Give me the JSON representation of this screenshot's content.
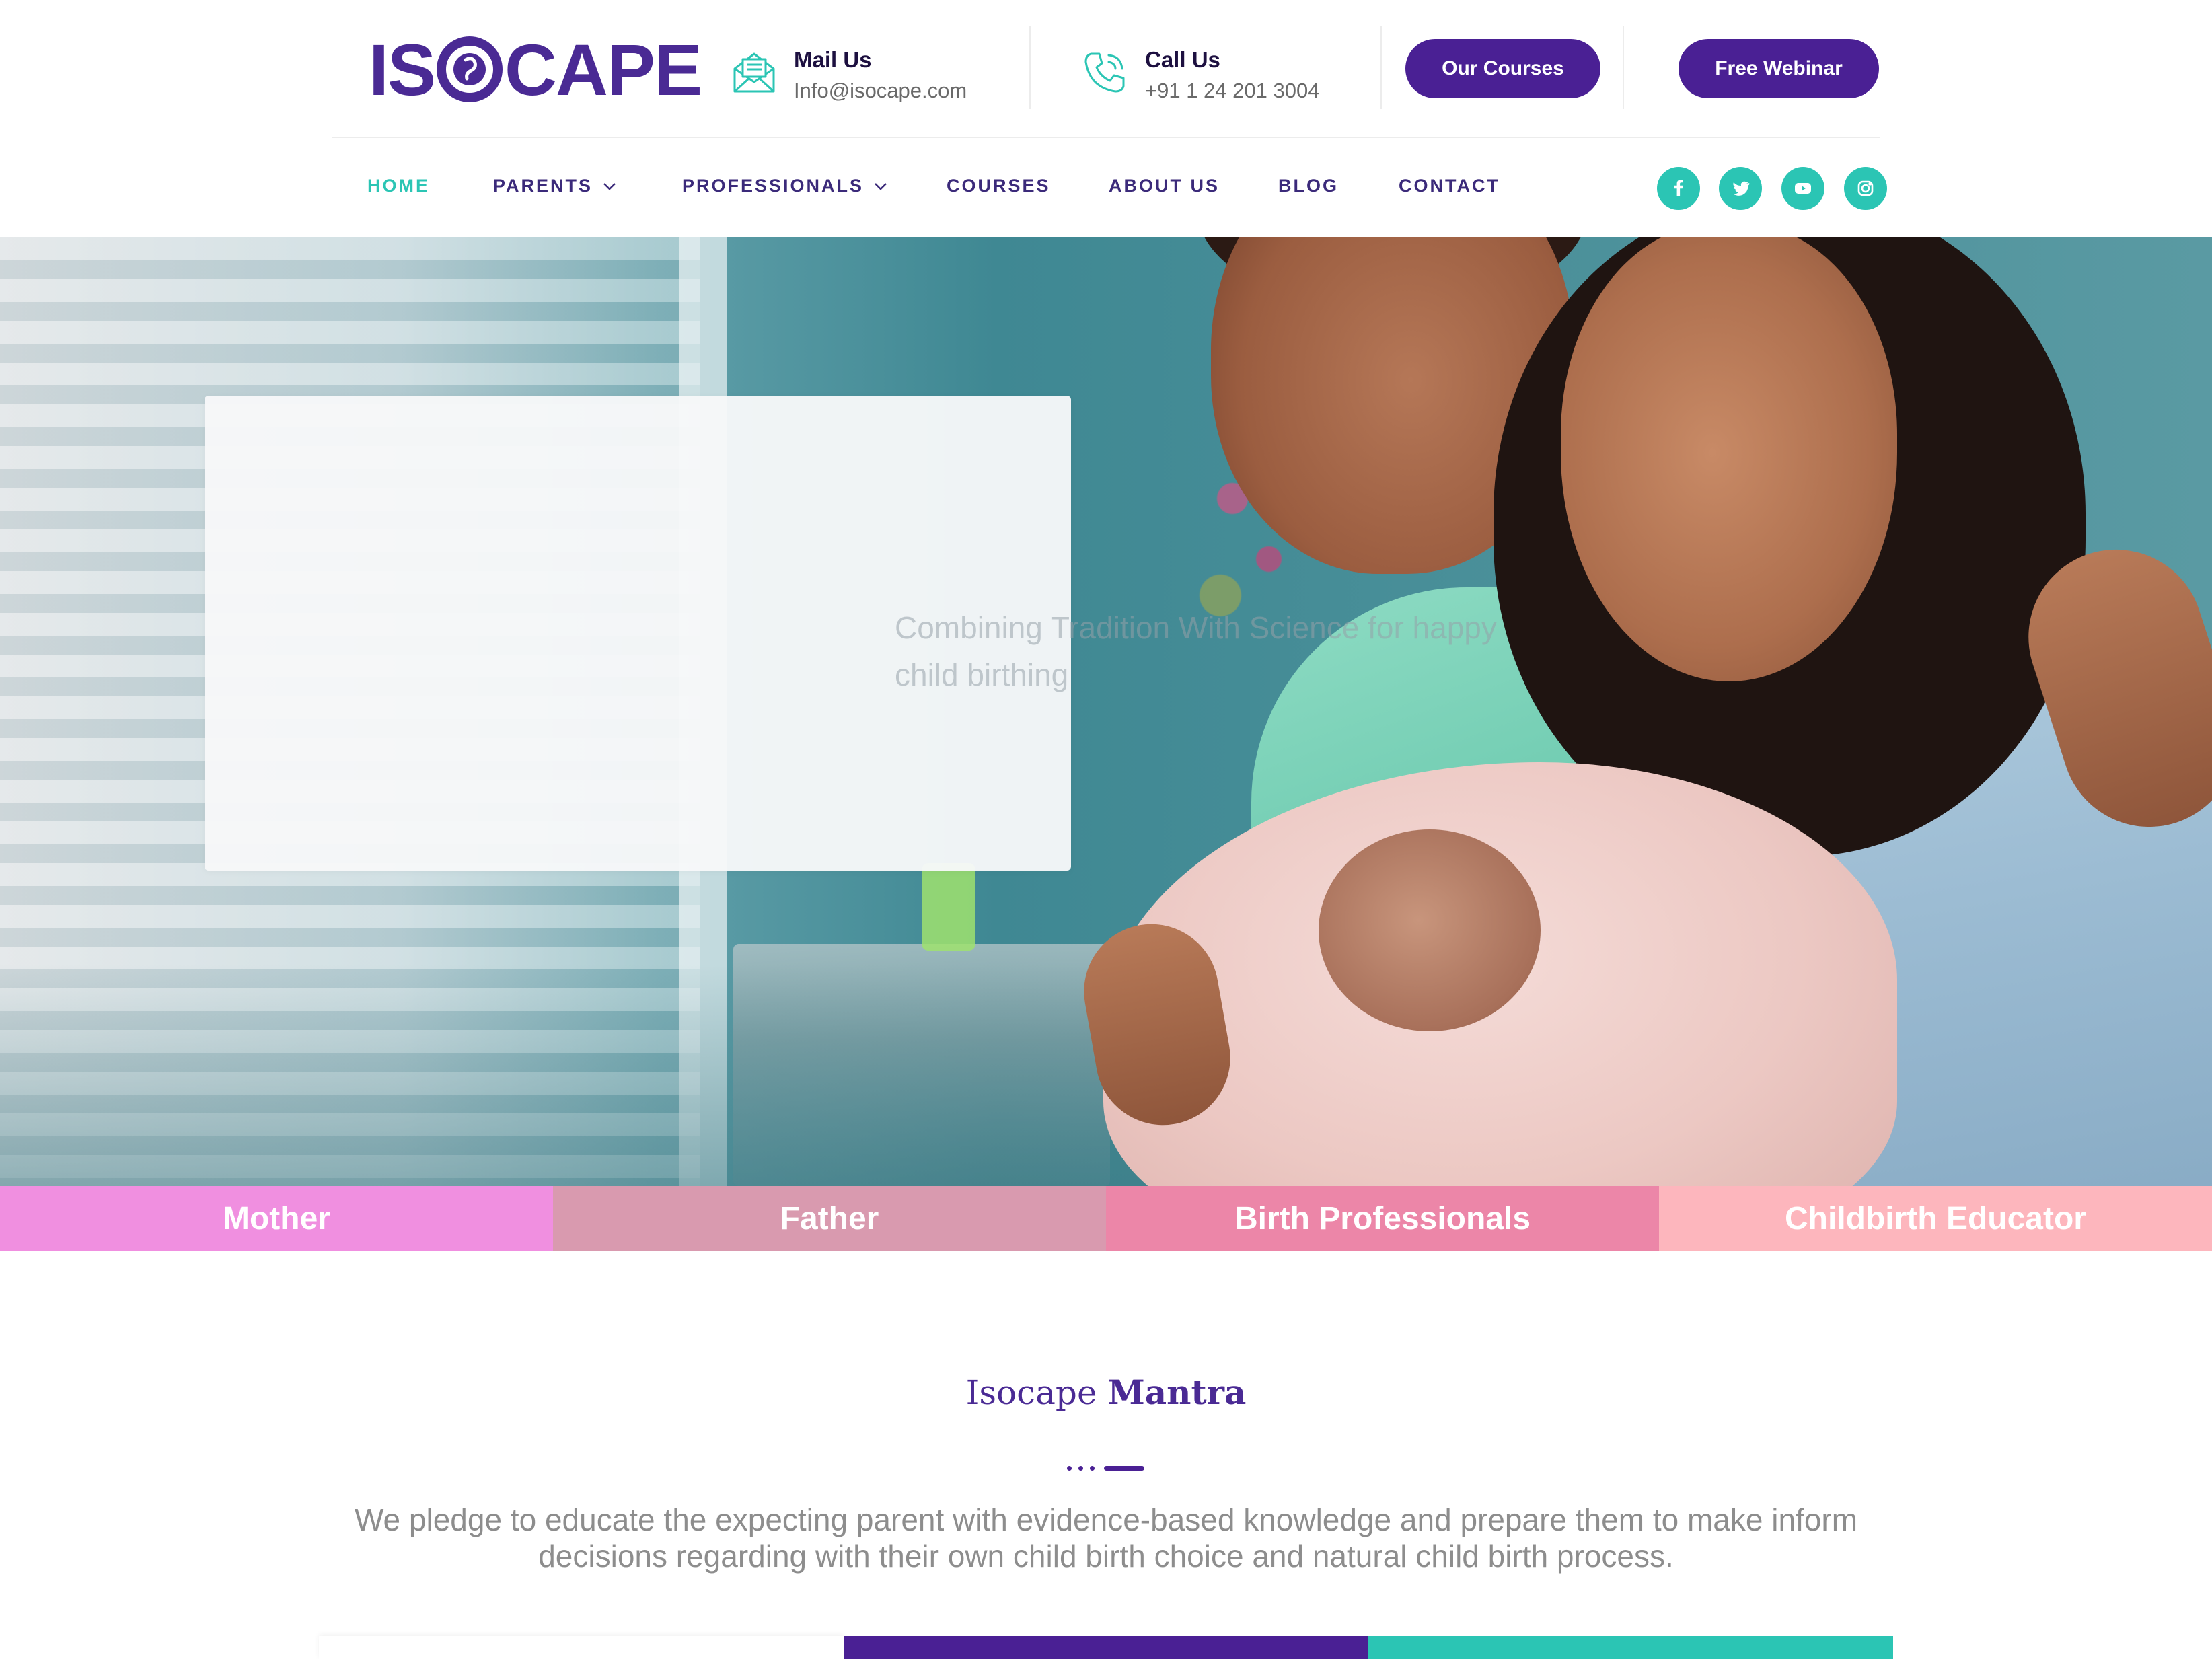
{
  "brand": {
    "logo_left": "IS",
    "logo_right": "CAPE",
    "color_primary": "#4a2094",
    "color_accent": "#2bc5b4"
  },
  "header": {
    "mail": {
      "title": "Mail Us",
      "value": "Info@isocape.com",
      "icon": "envelope-icon"
    },
    "call": {
      "title": "Call Us",
      "value": "+91 1 24 201 3004",
      "icon": "phone-icon"
    },
    "buttons": {
      "courses": "Our Courses",
      "webinar": "Free Webinar"
    }
  },
  "nav": {
    "items": [
      {
        "label": "HOME",
        "active": true
      },
      {
        "label": "PARENTS",
        "dropdown": true
      },
      {
        "label": "PROFESSIONALS",
        "dropdown": true
      },
      {
        "label": "COURSES"
      },
      {
        "label": "ABOUT US"
      },
      {
        "label": "BLOG"
      },
      {
        "label": "CONTACT"
      }
    ],
    "social": [
      "facebook-icon",
      "twitter-icon",
      "youtube-icon",
      "instagram-icon"
    ]
  },
  "hero": {
    "caption": "Combining Tradition With Science for happy child birthing"
  },
  "categories": [
    "Mother",
    "Father",
    "Birth Professionals",
    "Childbirth Educator"
  ],
  "mantra": {
    "title_part1": "Isocape",
    "title_part2": "Mantra",
    "text": "We pledge to educate the expecting parent with evidence-based knowledge and prepare them to make inform decisions regarding with their own child birth choice and natural child birth process."
  }
}
